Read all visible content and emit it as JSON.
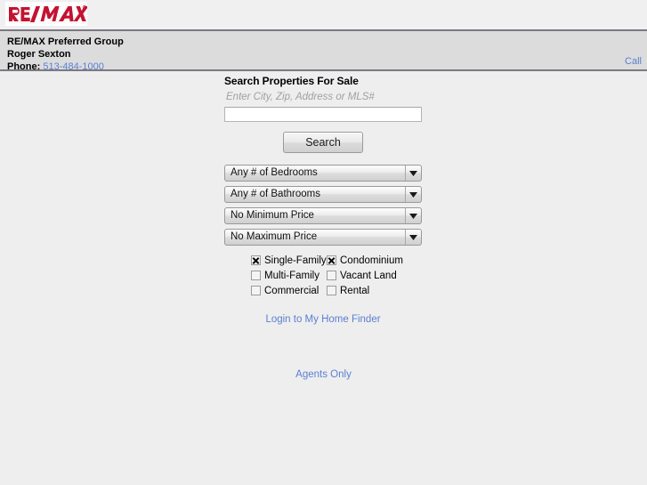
{
  "brand": {
    "logo_text": "RE/MAX",
    "logo_trademark": "®",
    "logo_color": "#c41230"
  },
  "office": {
    "name": "RE/MAX Preferred Group",
    "agent": "Roger Sexton",
    "phone_label": "Phone:",
    "phone_number": "513-484-1000",
    "call_link": "Call"
  },
  "search": {
    "title": "Search Properties For Sale",
    "hint": "Enter City, Zip, Address or MLS#",
    "input_value": "",
    "placeholder": "",
    "button_label": "Search"
  },
  "filters": {
    "selects": [
      {
        "name": "bedrooms",
        "value": "Any # of Bedrooms"
      },
      {
        "name": "bathrooms",
        "value": "Any # of Bathrooms"
      },
      {
        "name": "min-price",
        "value": "No Minimum Price"
      },
      {
        "name": "max-price",
        "value": "No Maximum Price"
      }
    ],
    "property_types": [
      {
        "label": "Single-Family",
        "checked": true
      },
      {
        "label": "Condominium",
        "checked": true
      },
      {
        "label": "Multi-Family",
        "checked": false
      },
      {
        "label": "Vacant Land",
        "checked": false
      },
      {
        "label": "Commercial",
        "checked": false
      },
      {
        "label": "Rental",
        "checked": false
      }
    ]
  },
  "links": {
    "home_finder": "Login to My Home Finder",
    "agents_only": "Agents Only"
  },
  "colors": {
    "link_blue": "#5a7fd4",
    "brand_red": "#c41230",
    "page_bg": "#eeeeee",
    "info_bar_bg": "#dcdcdc"
  }
}
